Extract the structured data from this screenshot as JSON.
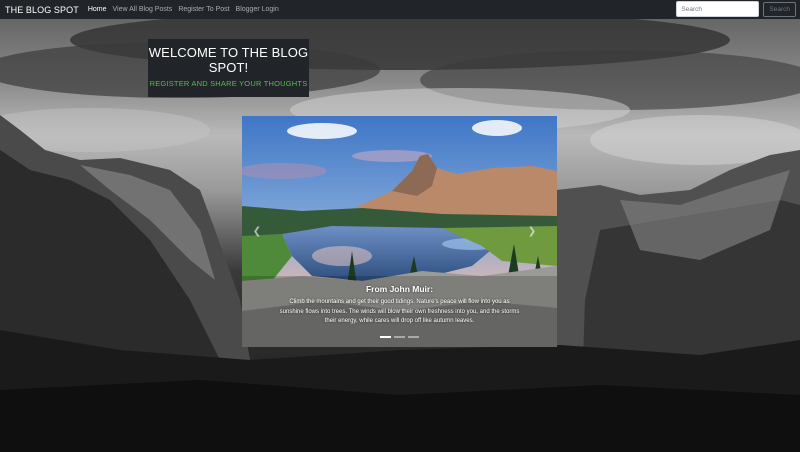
{
  "navbar": {
    "brand": "THE BLOG SPOT",
    "links": [
      {
        "label": "Home",
        "active": true
      },
      {
        "label": "View All Blog Posts",
        "active": false
      },
      {
        "label": "Register To Post",
        "active": false
      },
      {
        "label": "Blogger Login",
        "active": false
      }
    ],
    "search_placeholder": "Search",
    "search_button": "Search"
  },
  "welcome": {
    "title": "WELCOME TO THE BLOG SPOT!",
    "subtitle": "REGISTER AND SHARE YOUR THOUGHTS"
  },
  "carousel": {
    "caption_title": "From John Muir:",
    "caption_text": "Climb the mountains and get their good tidings. Nature's peace will flow into you as sunshine flows into trees. The winds will blow their own freshness into you, and the storms their energy, while cares will drop off like autumn leaves.",
    "slide_count": 3,
    "active_slide": 1
  },
  "colors": {
    "navbar_bg": "#212529",
    "accent_green": "#5cb85c"
  }
}
